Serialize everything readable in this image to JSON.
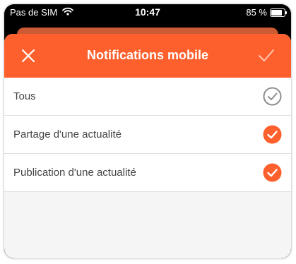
{
  "status_bar": {
    "carrier": "Pas de SIM",
    "time": "10:47",
    "battery_percent": "85 %",
    "battery_level": 0.85
  },
  "header": {
    "title": "Notifications mobile",
    "close_icon": "close-icon",
    "confirm_icon": "check-icon"
  },
  "options": [
    {
      "label": "Tous",
      "checked": false
    },
    {
      "label": "Partage d'une actualité",
      "checked": true
    },
    {
      "label": "Publication d'une actualité",
      "checked": true
    }
  ],
  "colors": {
    "accent": "#fd602c",
    "unchecked": "#8e8e8e"
  }
}
